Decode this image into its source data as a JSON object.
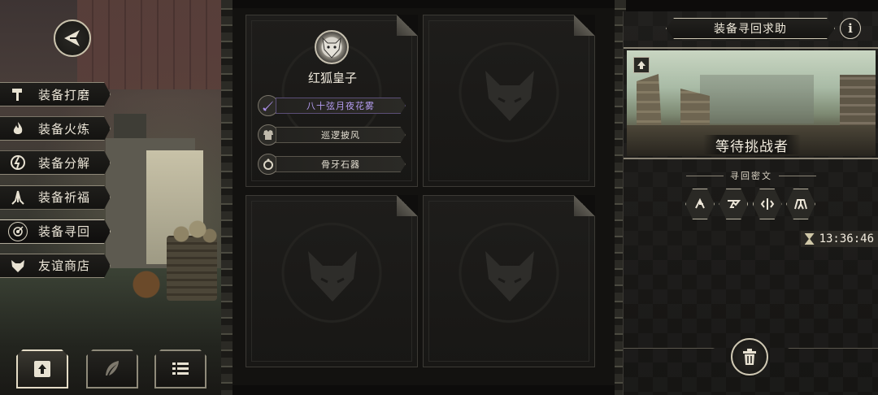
{
  "menu": {
    "items": [
      {
        "label": "装备打磨",
        "icon": "hammer-icon"
      },
      {
        "label": "装备火炼",
        "icon": "flame-icon"
      },
      {
        "label": "装备分解",
        "icon": "decompose-icon"
      },
      {
        "label": "装备祈福",
        "icon": "prayer-hands-icon"
      },
      {
        "label": "装备寻回",
        "icon": "target-icon",
        "active": true
      },
      {
        "label": "友谊商店",
        "icon": "fox-head-icon"
      }
    ]
  },
  "bottom_bar": {
    "buttons": [
      {
        "icon": "upload-icon",
        "active": true
      },
      {
        "icon": "feather-icon"
      },
      {
        "icon": "list-icon"
      }
    ]
  },
  "slot1": {
    "boss_name": "红狐皇子",
    "equipment": [
      {
        "name": "八十弦月夜花雾",
        "icon": "sword-icon",
        "rarity_color": "#b49cf0"
      },
      {
        "name": "巡逻披风",
        "icon": "armor-icon"
      },
      {
        "name": "骨牙石器",
        "icon": "ring-icon"
      }
    ]
  },
  "right_panel": {
    "title": "装备寻回求助",
    "info_label": "i",
    "status": "等待挑战者",
    "cipher_label": "寻回密文",
    "runes": [
      "rune-1-icon",
      "rune-2-icon",
      "rune-3-icon",
      "rune-4-icon"
    ],
    "timer": "13:36:46"
  }
}
